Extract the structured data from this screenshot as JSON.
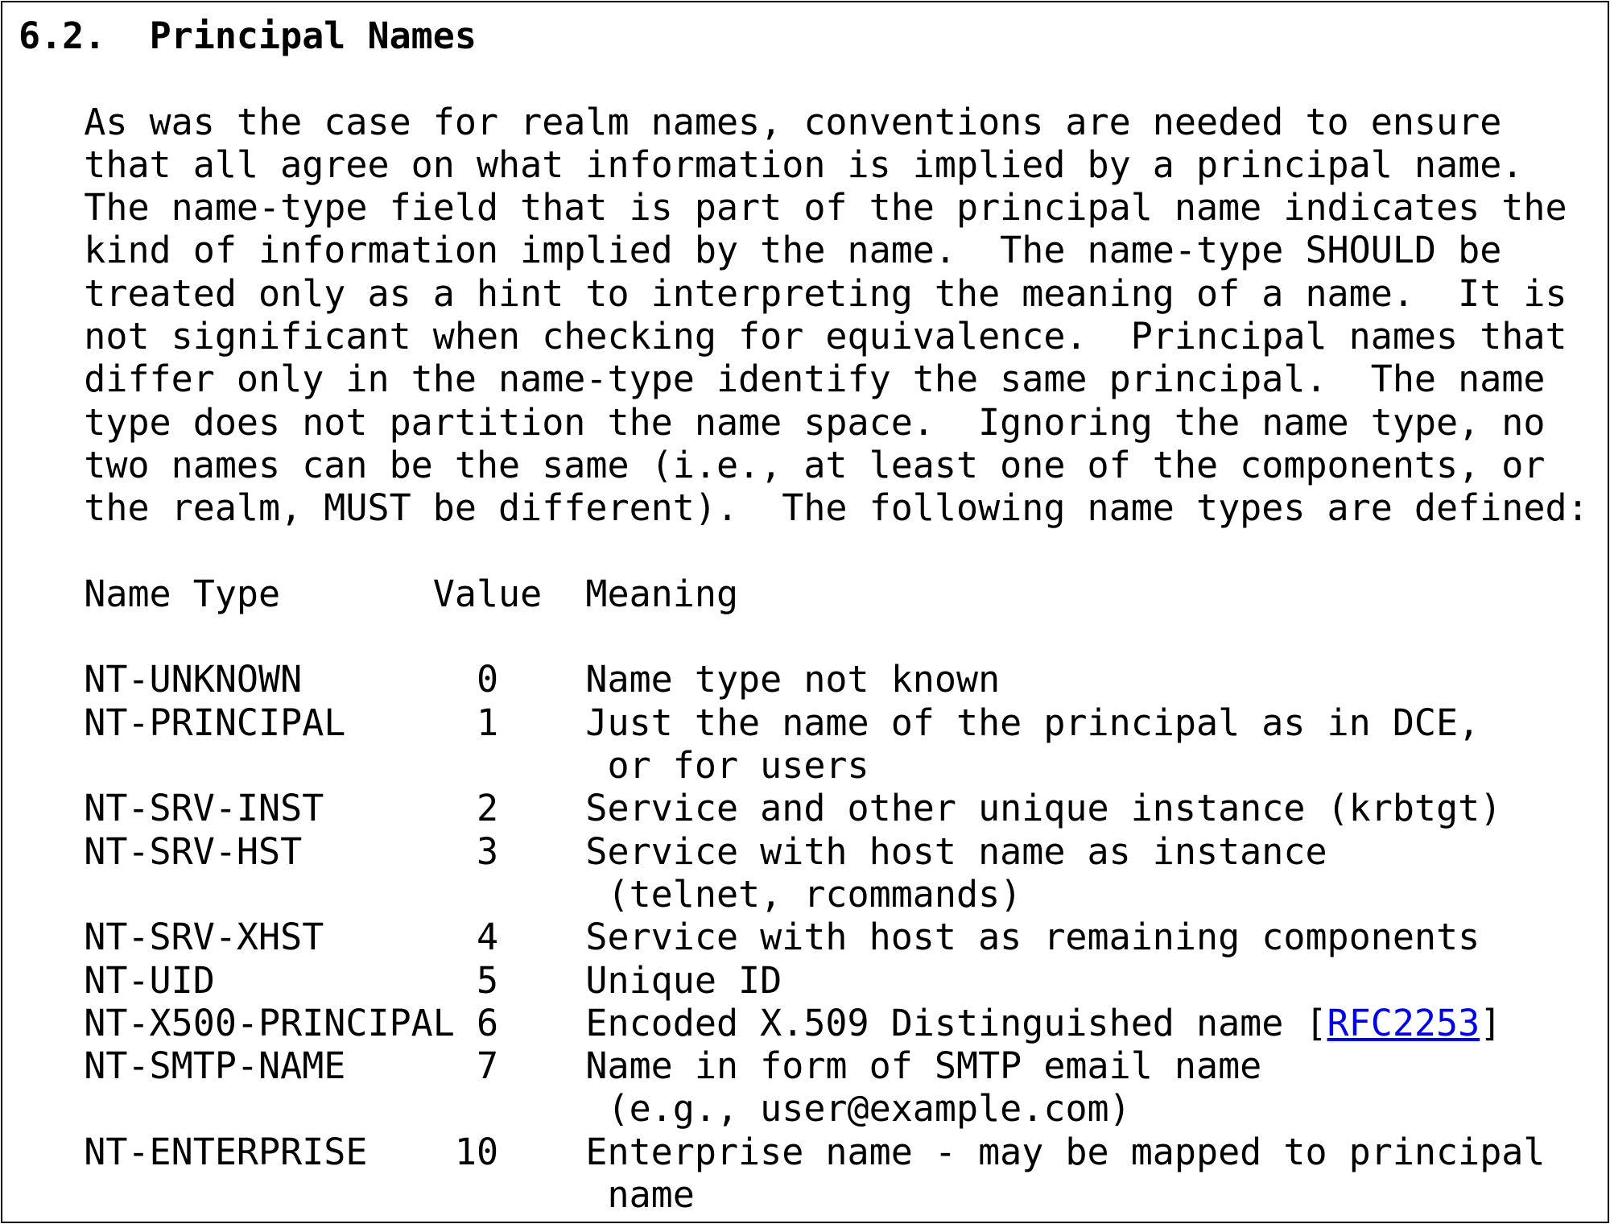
{
  "section": {
    "number": "6.2.",
    "title": "Principal Names"
  },
  "paragraph_lines": [
    "As was the case for realm names, conventions are needed to ensure",
    "that all agree on what information is implied by a principal name.",
    "The name-type field that is part of the principal name indicates the",
    "kind of information implied by the name.  The name-type SHOULD be",
    "treated only as a hint to interpreting the meaning of a name.  It is",
    "not significant when checking for equivalence.  Principal names that",
    "differ only in the name-type identify the same principal.  The name",
    "type does not partition the name space.  Ignoring the name type, no",
    "two names can be the same (i.e., at least one of the components, or",
    "the realm, MUST be different).  The following name types are defined:"
  ],
  "table": {
    "header_line": "Name Type       Value  Meaning",
    "rows": [
      {
        "line": "NT-UNKNOWN        0    Name type not known"
      },
      {
        "line": "NT-PRINCIPAL      1    Just the name of the principal as in DCE,",
        "cont": "or for users"
      },
      {
        "line": "NT-SRV-INST       2    Service and other unique instance (krbtgt)"
      },
      {
        "line": "NT-SRV-HST        3    Service with host name as instance",
        "cont": "(telnet, rcommands)"
      },
      {
        "line": "NT-SRV-XHST       4    Service with host as remaining components"
      },
      {
        "line": "NT-UID            5    Unique ID"
      },
      {
        "line": "NT-X500-PRINCIPAL 6    Encoded X.509 Distinguished name [",
        "link": "RFC2253",
        "after": "]"
      },
      {
        "line": "NT-SMTP-NAME      7    Name in form of SMTP email name",
        "cont": "(e.g., user@example.com)"
      },
      {
        "line": "NT-ENTERPRISE    10    Enterprise name - may be mapped to principal",
        "cont": "name"
      }
    ]
  }
}
